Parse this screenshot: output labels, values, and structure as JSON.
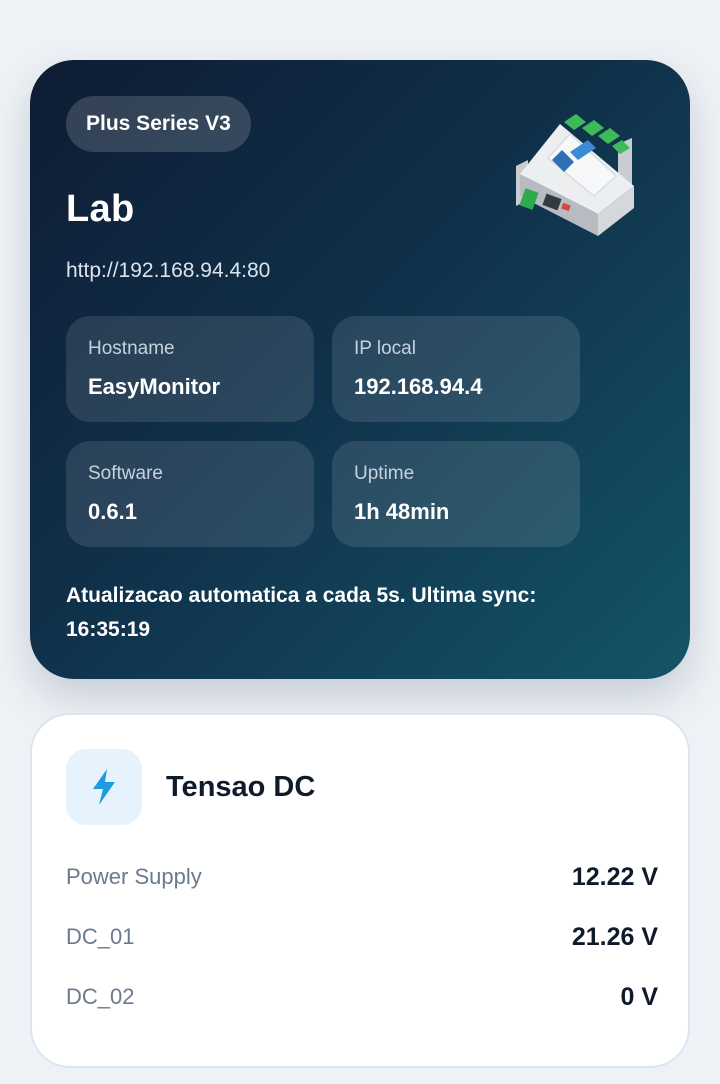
{
  "device": {
    "badge": "Plus Series V3",
    "name": "Lab",
    "url": "http://192.168.94.4:80",
    "info": [
      {
        "label": "Hostname",
        "value": "EasyMonitor"
      },
      {
        "label": "IP local",
        "value": "192.168.94.4"
      },
      {
        "label": "Software",
        "value": "0.6.1"
      },
      {
        "label": "Uptime",
        "value": "1h 48min"
      }
    ],
    "sync_text": "Atualizacao automatica a cada 5s. Ultima sync: 16:35:19",
    "image_icon": "device-module-icon"
  },
  "voltage_card": {
    "icon": "lightning-bolt-icon",
    "title": "Tensao DC",
    "rows": [
      {
        "label": "Power Supply",
        "value": "12.22 V"
      },
      {
        "label": "DC_01",
        "value": "21.26 V"
      },
      {
        "label": "DC_02",
        "value": "0 V"
      }
    ]
  },
  "colors": {
    "hero_gradient_start": "#0e1c33",
    "hero_gradient_end": "#145466",
    "accent_blue": "#1e9be0",
    "icon_bg": "#e6f3fc",
    "page_bg": "#eef2f6"
  }
}
